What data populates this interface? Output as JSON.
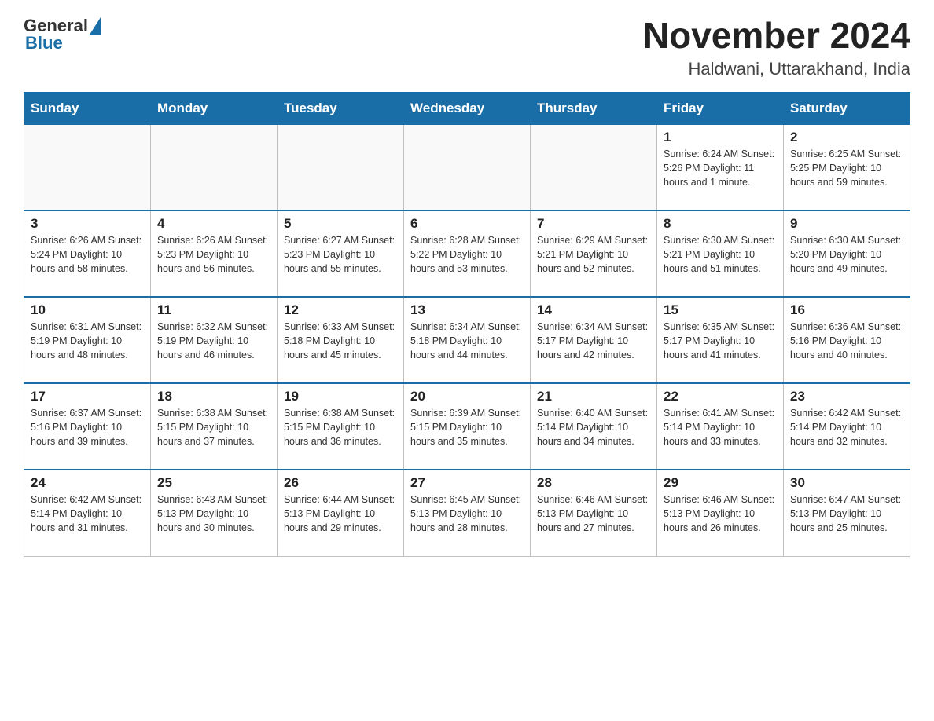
{
  "header": {
    "logo_general": "General",
    "logo_blue": "Blue",
    "month_year": "November 2024",
    "location": "Haldwani, Uttarakhand, India"
  },
  "days_of_week": [
    "Sunday",
    "Monday",
    "Tuesday",
    "Wednesday",
    "Thursday",
    "Friday",
    "Saturday"
  ],
  "weeks": [
    [
      {
        "num": "",
        "info": ""
      },
      {
        "num": "",
        "info": ""
      },
      {
        "num": "",
        "info": ""
      },
      {
        "num": "",
        "info": ""
      },
      {
        "num": "",
        "info": ""
      },
      {
        "num": "1",
        "info": "Sunrise: 6:24 AM\nSunset: 5:26 PM\nDaylight: 11 hours and 1 minute."
      },
      {
        "num": "2",
        "info": "Sunrise: 6:25 AM\nSunset: 5:25 PM\nDaylight: 10 hours and 59 minutes."
      }
    ],
    [
      {
        "num": "3",
        "info": "Sunrise: 6:26 AM\nSunset: 5:24 PM\nDaylight: 10 hours and 58 minutes."
      },
      {
        "num": "4",
        "info": "Sunrise: 6:26 AM\nSunset: 5:23 PM\nDaylight: 10 hours and 56 minutes."
      },
      {
        "num": "5",
        "info": "Sunrise: 6:27 AM\nSunset: 5:23 PM\nDaylight: 10 hours and 55 minutes."
      },
      {
        "num": "6",
        "info": "Sunrise: 6:28 AM\nSunset: 5:22 PM\nDaylight: 10 hours and 53 minutes."
      },
      {
        "num": "7",
        "info": "Sunrise: 6:29 AM\nSunset: 5:21 PM\nDaylight: 10 hours and 52 minutes."
      },
      {
        "num": "8",
        "info": "Sunrise: 6:30 AM\nSunset: 5:21 PM\nDaylight: 10 hours and 51 minutes."
      },
      {
        "num": "9",
        "info": "Sunrise: 6:30 AM\nSunset: 5:20 PM\nDaylight: 10 hours and 49 minutes."
      }
    ],
    [
      {
        "num": "10",
        "info": "Sunrise: 6:31 AM\nSunset: 5:19 PM\nDaylight: 10 hours and 48 minutes."
      },
      {
        "num": "11",
        "info": "Sunrise: 6:32 AM\nSunset: 5:19 PM\nDaylight: 10 hours and 46 minutes."
      },
      {
        "num": "12",
        "info": "Sunrise: 6:33 AM\nSunset: 5:18 PM\nDaylight: 10 hours and 45 minutes."
      },
      {
        "num": "13",
        "info": "Sunrise: 6:34 AM\nSunset: 5:18 PM\nDaylight: 10 hours and 44 minutes."
      },
      {
        "num": "14",
        "info": "Sunrise: 6:34 AM\nSunset: 5:17 PM\nDaylight: 10 hours and 42 minutes."
      },
      {
        "num": "15",
        "info": "Sunrise: 6:35 AM\nSunset: 5:17 PM\nDaylight: 10 hours and 41 minutes."
      },
      {
        "num": "16",
        "info": "Sunrise: 6:36 AM\nSunset: 5:16 PM\nDaylight: 10 hours and 40 minutes."
      }
    ],
    [
      {
        "num": "17",
        "info": "Sunrise: 6:37 AM\nSunset: 5:16 PM\nDaylight: 10 hours and 39 minutes."
      },
      {
        "num": "18",
        "info": "Sunrise: 6:38 AM\nSunset: 5:15 PM\nDaylight: 10 hours and 37 minutes."
      },
      {
        "num": "19",
        "info": "Sunrise: 6:38 AM\nSunset: 5:15 PM\nDaylight: 10 hours and 36 minutes."
      },
      {
        "num": "20",
        "info": "Sunrise: 6:39 AM\nSunset: 5:15 PM\nDaylight: 10 hours and 35 minutes."
      },
      {
        "num": "21",
        "info": "Sunrise: 6:40 AM\nSunset: 5:14 PM\nDaylight: 10 hours and 34 minutes."
      },
      {
        "num": "22",
        "info": "Sunrise: 6:41 AM\nSunset: 5:14 PM\nDaylight: 10 hours and 33 minutes."
      },
      {
        "num": "23",
        "info": "Sunrise: 6:42 AM\nSunset: 5:14 PM\nDaylight: 10 hours and 32 minutes."
      }
    ],
    [
      {
        "num": "24",
        "info": "Sunrise: 6:42 AM\nSunset: 5:14 PM\nDaylight: 10 hours and 31 minutes."
      },
      {
        "num": "25",
        "info": "Sunrise: 6:43 AM\nSunset: 5:13 PM\nDaylight: 10 hours and 30 minutes."
      },
      {
        "num": "26",
        "info": "Sunrise: 6:44 AM\nSunset: 5:13 PM\nDaylight: 10 hours and 29 minutes."
      },
      {
        "num": "27",
        "info": "Sunrise: 6:45 AM\nSunset: 5:13 PM\nDaylight: 10 hours and 28 minutes."
      },
      {
        "num": "28",
        "info": "Sunrise: 6:46 AM\nSunset: 5:13 PM\nDaylight: 10 hours and 27 minutes."
      },
      {
        "num": "29",
        "info": "Sunrise: 6:46 AM\nSunset: 5:13 PM\nDaylight: 10 hours and 26 minutes."
      },
      {
        "num": "30",
        "info": "Sunrise: 6:47 AM\nSunset: 5:13 PM\nDaylight: 10 hours and 25 minutes."
      }
    ]
  ]
}
